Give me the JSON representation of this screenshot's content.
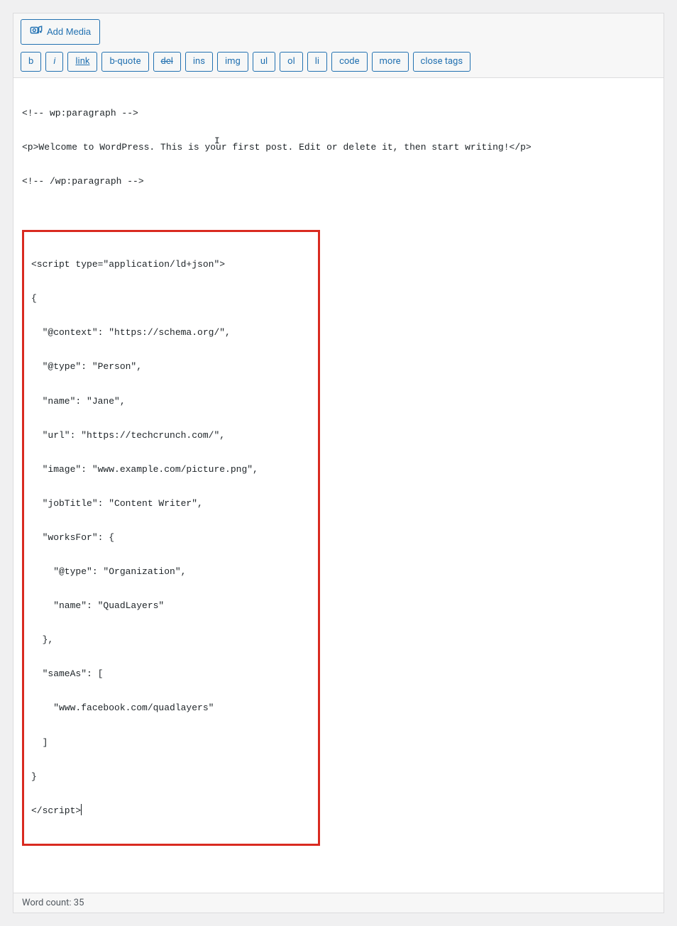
{
  "media": {
    "add_label": "Add Media"
  },
  "toolbar": {
    "b": "b",
    "i": "i",
    "link": "link",
    "bquote": "b-quote",
    "del": "del",
    "ins": "ins",
    "img": "img",
    "ul": "ul",
    "ol": "ol",
    "li": "li",
    "code": "code",
    "more": "more",
    "close": "close tags"
  },
  "editor": {
    "line1": "<!-- wp:paragraph -->",
    "line2": "<p>Welcome to WordPress. This is your first post. Edit or delete it, then start writing!</p>",
    "line3": "<!-- /wp:paragraph -->",
    "s0": "<script type=\"application/ld+json\">",
    "s1": "{",
    "s2": "  \"@context\": \"https://schema.org/\",",
    "s3": "  \"@type\": \"Person\",",
    "s4": "  \"name\": \"Jane\",",
    "s5": "  \"url\": \"https://techcrunch.com/\",",
    "s6": "  \"image\": \"www.example.com/picture.png\",",
    "s7": "  \"jobTitle\": \"Content Writer\",",
    "s8": "  \"worksFor\": {",
    "s9": "    \"@type\": \"Organization\",",
    "s10": "    \"name\": \"QuadLayers\"",
    "s11": "  },",
    "s12": "  \"sameAs\": [",
    "s13": "    \"www.facebook.com/quadlayers\"",
    "s14": "  ]",
    "s15": "}",
    "s16": "</script>"
  },
  "status": {
    "word_count_label": "Word count: 35"
  }
}
